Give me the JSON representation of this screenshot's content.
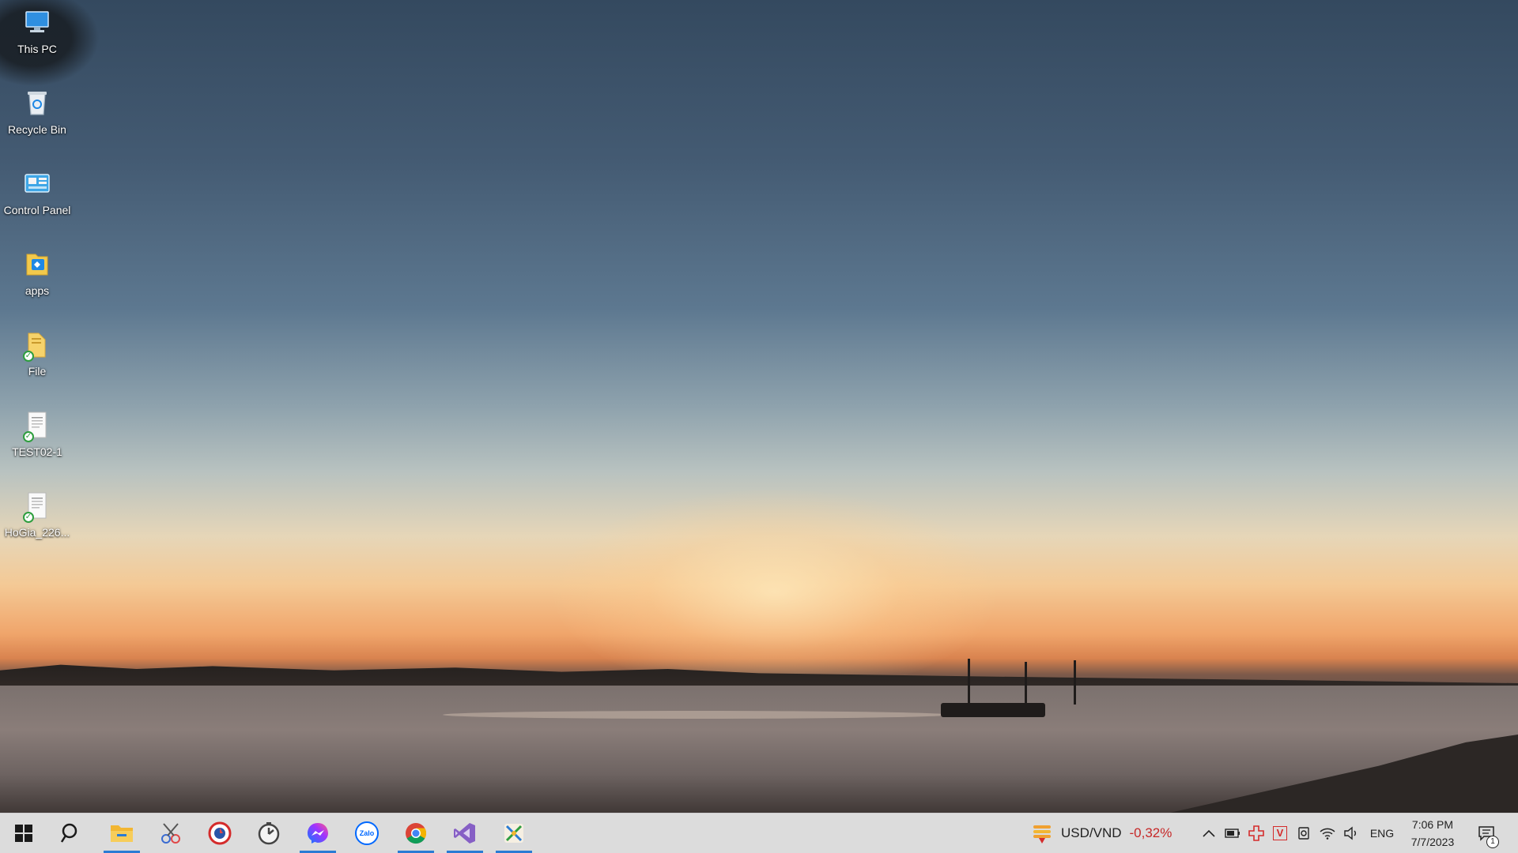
{
  "desktop_icons": [
    {
      "label": "This PC",
      "icon": "this-pc-icon"
    },
    {
      "label": "Recycle Bin",
      "icon": "recycle-bin-icon"
    },
    {
      "label": "Control Panel",
      "icon": "control-panel-icon"
    },
    {
      "label": "apps",
      "icon": "apps-folder-icon"
    },
    {
      "label": "File",
      "icon": "folder-icon"
    },
    {
      "label": "TEST02-1",
      "icon": "document-icon"
    },
    {
      "label": "HoGia_226...",
      "icon": "document-icon"
    }
  ],
  "taskbar": {
    "pinned": [
      {
        "name": "start",
        "icon": "windows-start-icon"
      },
      {
        "name": "search",
        "icon": "search-icon"
      },
      {
        "name": "file-explorer",
        "icon": "file-explorer-icon",
        "active": true
      },
      {
        "name": "snipping",
        "icon": "snipping-tool-icon"
      },
      {
        "name": "app-red",
        "icon": "red-circle-app-icon"
      },
      {
        "name": "clock-app",
        "icon": "clock-app-icon"
      },
      {
        "name": "messenger",
        "icon": "messenger-icon",
        "active": true
      },
      {
        "name": "zalo",
        "icon": "zalo-icon"
      },
      {
        "name": "chrome",
        "icon": "chrome-icon",
        "active": true
      },
      {
        "name": "visual-studio",
        "icon": "visual-studio-icon",
        "active": true
      },
      {
        "name": "tool-app",
        "icon": "tool-app-icon",
        "active": true
      }
    ],
    "zalo_label": "Zalo",
    "widget": {
      "label": "USD/VND",
      "change": "-0,32%",
      "change_color": "#c62828"
    },
    "tray": {
      "language": "ENG",
      "time": "7:06 PM",
      "date": "7/7/2023",
      "notification_count": "1"
    }
  }
}
